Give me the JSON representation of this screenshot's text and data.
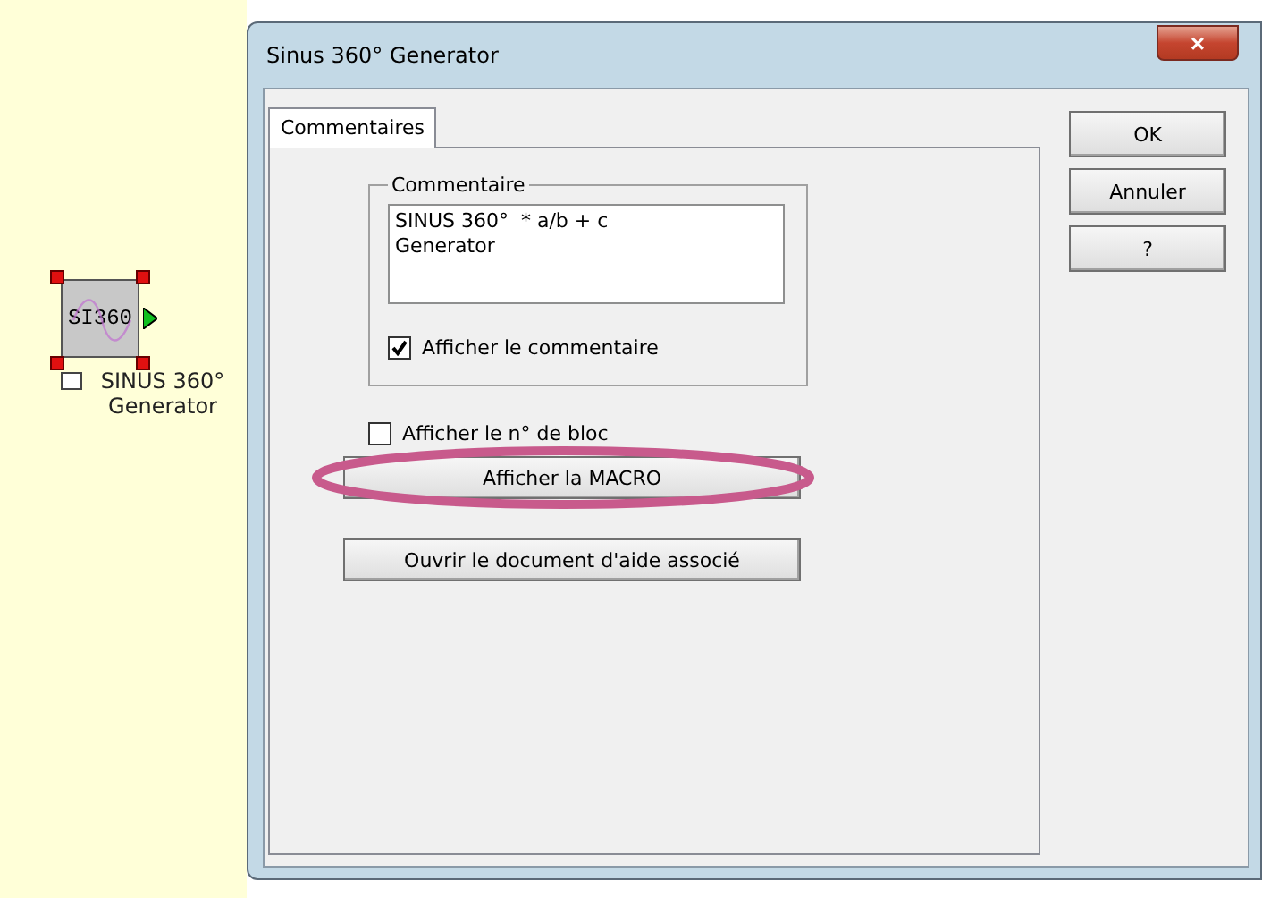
{
  "canvas": {
    "block": {
      "symbol": "SI360",
      "caption": "SINUS 360°\nGenerator",
      "selected": true
    }
  },
  "window": {
    "title": "Sinus 360° Generator",
    "close": "×"
  },
  "tabs": [
    {
      "label": "Commentaires",
      "selected": true
    }
  ],
  "comment_group": {
    "title": "Commentaire",
    "text": "SINUS 360°  * a/b + c\nGenerator",
    "checkbox": {
      "label": "Afficher le commentaire",
      "checked": true
    }
  },
  "block_number_checkbox": {
    "label": "Afficher le n° de bloc",
    "checked": false
  },
  "buttons": [
    {
      "label": "Afficher la MACRO",
      "highlighted": true
    },
    {
      "label": "Ouvrir le document d'aide associé",
      "highlighted": false
    }
  ],
  "side_buttons": [
    "OK",
    "Annuler",
    "?"
  ]
}
